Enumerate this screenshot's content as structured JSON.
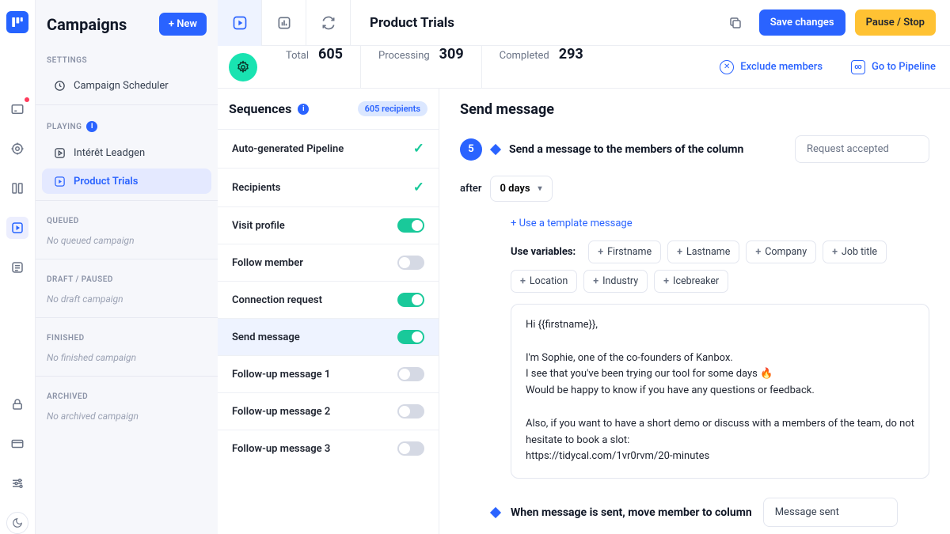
{
  "rail": {
    "badge_on": 0
  },
  "left": {
    "title": "Campaigns",
    "new_label": "+ New",
    "sections": {
      "settings_label": "SETTINGS",
      "scheduler": "Campaign Scheduler",
      "playing_label": "PLAYING",
      "playing_items": [
        "Intérêt Leadgen",
        "Product Trials"
      ],
      "queued_label": "QUEUED",
      "queued_empty": "No queued campaign",
      "draft_label": "DRAFT / PAUSED",
      "draft_empty": "No draft campaign",
      "finished_label": "FINISHED",
      "finished_empty": "No finished campaign",
      "archived_label": "ARCHIVED",
      "archived_empty": "No archived campaign"
    }
  },
  "topbar": {
    "title": "Product Trials",
    "save_label": "Save changes",
    "pause_label": "Pause / Stop"
  },
  "stats": {
    "total_label": "Total",
    "total_value": "605",
    "processing_label": "Processing",
    "processing_value": "309",
    "completed_label": "Completed",
    "completed_value": "293",
    "exclude_label": "Exclude members",
    "pipeline_label": "Go to Pipeline"
  },
  "sequences": {
    "title": "Sequences",
    "recipients_badge": "605 recipients",
    "items": [
      {
        "label": "Auto-generated Pipeline",
        "state": "check"
      },
      {
        "label": "Recipients",
        "state": "check"
      },
      {
        "label": "Visit profile",
        "state": "on"
      },
      {
        "label": "Follow member",
        "state": "off"
      },
      {
        "label": "Connection request",
        "state": "on"
      },
      {
        "label": "Send message",
        "state": "on",
        "selected": true
      },
      {
        "label": "Follow-up message 1",
        "state": "off"
      },
      {
        "label": "Follow-up message 2",
        "state": "off"
      },
      {
        "label": "Follow-up message 3",
        "state": "off"
      }
    ]
  },
  "editor": {
    "heading": "Send message",
    "step_number": "5",
    "step_title": "Send a message to the members of the column",
    "column_value": "Request accepted",
    "after_label": "after",
    "delay_value": "0 days",
    "template_link": "+ Use a template message",
    "vars_label": "Use variables:",
    "vars": [
      "Firstname",
      "Lastname",
      "Company",
      "Job title",
      "Location",
      "Industry",
      "Icebreaker"
    ],
    "message_body": "Hi {{firstname}},\n\nI'm Sophie, one of the co-founders of Kanbox.\nI see that you've been trying our tool for some days 🔥\nWould be happy to know if you have any questions or feedback.\n\nAlso, if you want to have a short demo or discuss with a members of the team, do not hesitate to book a slot:\nhttps://tidycal.com/1vr0rvm/20-minutes",
    "move_title": "When message is sent, move member to column",
    "move_value": "Message sent"
  }
}
